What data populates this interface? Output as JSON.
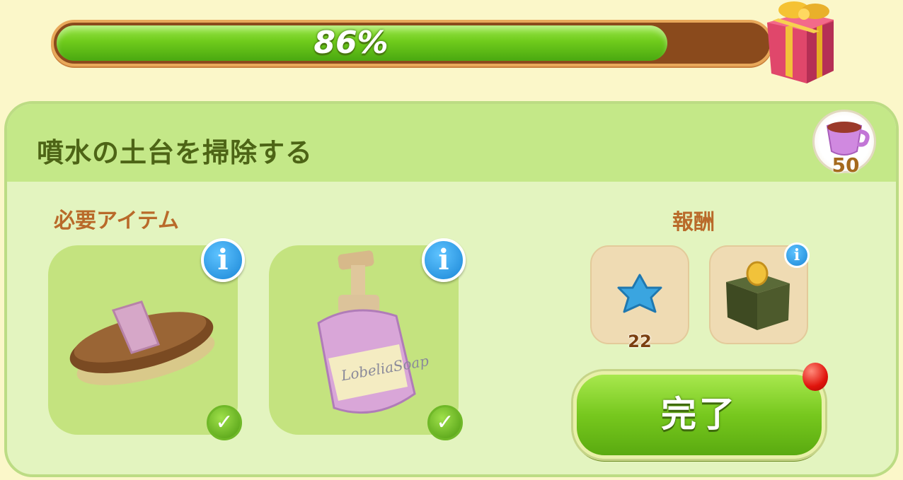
{
  "progress": {
    "label": "86%",
    "value": 0.86
  },
  "task": {
    "title": "噴水の土台を掃除する",
    "cup_reward": "50"
  },
  "required": {
    "label": "必要アイテム",
    "items": [
      {
        "icon": "brush-icon",
        "info": "i",
        "check": "✓"
      },
      {
        "icon": "soap-bottle-icon",
        "soap_label": "LobeliaSoap",
        "info": "i",
        "check": "✓"
      }
    ]
  },
  "rewards": {
    "label": "報酬",
    "items": [
      {
        "icon": "star-icon",
        "count": "22"
      },
      {
        "icon": "coin-box-icon",
        "info": "i"
      }
    ]
  },
  "complete_button": {
    "label": "完了"
  },
  "colors": {
    "progress_green": "#6fcb1c",
    "panel_bg": "#e3f4bf",
    "header_bg": "#c4e888",
    "title_text": "#4d6416",
    "section_label": "#b96a2a"
  }
}
